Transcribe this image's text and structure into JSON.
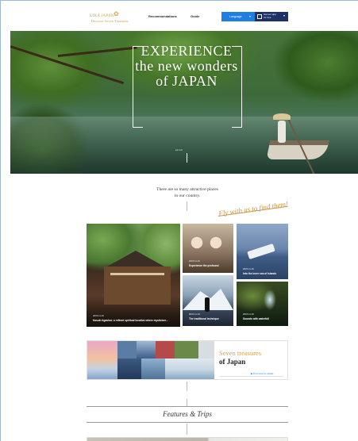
{
  "header": {
    "logo_line1": "KIKA JAPAN",
    "logo_line2": "Discover Seven Treasures",
    "nav": [
      "Recommendations",
      "Guide"
    ],
    "btn_language": "Language",
    "btn_app_line1": "Get our app",
    "btn_app_line2": "for free"
  },
  "hero": {
    "title_lines": [
      "EXPERIENCE",
      "the new wonders",
      "of JAPAN"
    ],
    "scroll_label": "scroll"
  },
  "intro": {
    "text_lines": [
      "There are so many attractive places",
      "in our country."
    ],
    "tagline": "Fly with us to find them!"
  },
  "cards": [
    {
      "date": "2015.11.16",
      "title": "Kasuki Agaotsu: a refined spiritual location where mysticism..."
    },
    {
      "date": "2015.11.16",
      "title": "Experience the profound"
    },
    {
      "date": "2015.11.16",
      "title": "Into the inner sea of islands"
    },
    {
      "date": "2015.11.16",
      "title": "The traditional technique"
    },
    {
      "date": "2015.11.16",
      "title": "Sounds with waterfall"
    }
  ],
  "seven": {
    "title_accent": "Seven treasures",
    "title_main": "of Japan",
    "link": "▶ Find more for details"
  },
  "features": {
    "title": "Features & Trips"
  },
  "colors": {
    "accent_gold": "#c9954a",
    "blue_button": "#1f7fe0",
    "navy_button": "#1d3166"
  }
}
